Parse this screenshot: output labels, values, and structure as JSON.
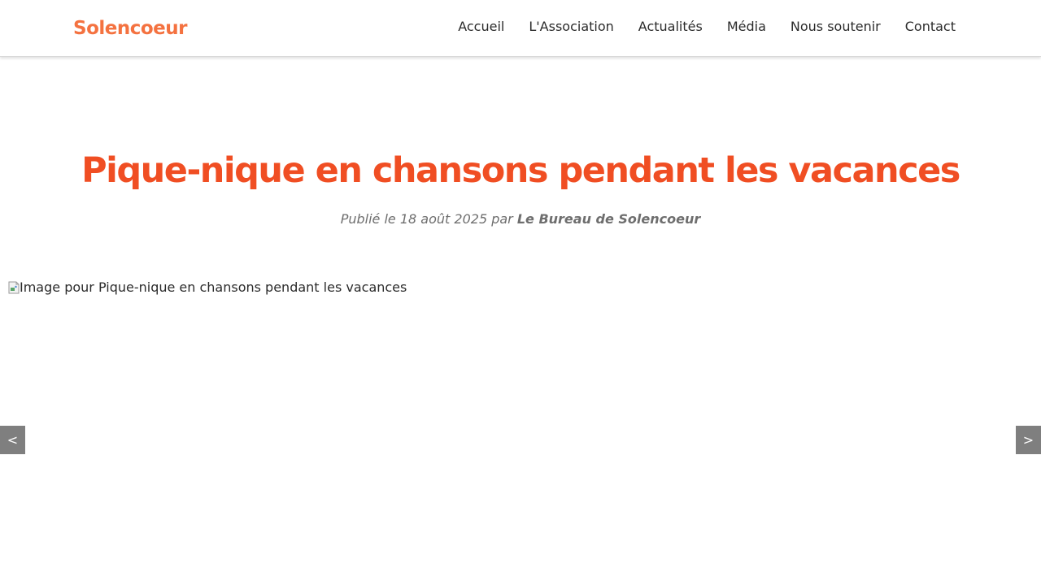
{
  "header": {
    "logo": "Solencoeur",
    "nav": [
      {
        "label": "Accueil"
      },
      {
        "label": "L'Association"
      },
      {
        "label": "Actualités"
      },
      {
        "label": "Média"
      },
      {
        "label": "Nous soutenir"
      },
      {
        "label": "Contact"
      }
    ]
  },
  "article": {
    "title": "Pique-nique en chansons pendant les vacances",
    "meta_prefix": "Publié le 18 août 2025 par ",
    "author": "Le Bureau de Solencoeur",
    "image_alt": "Image pour Pique-nique en chansons pendant les vacances"
  },
  "slider": {
    "prev_label": "<",
    "next_label": ">"
  },
  "colors": {
    "logo": "#f47240",
    "title": "#f04e23",
    "nav_text": "#2b2b2b",
    "meta_text": "#6e6e6e",
    "slider_button_bg": "#7f7f7f"
  }
}
